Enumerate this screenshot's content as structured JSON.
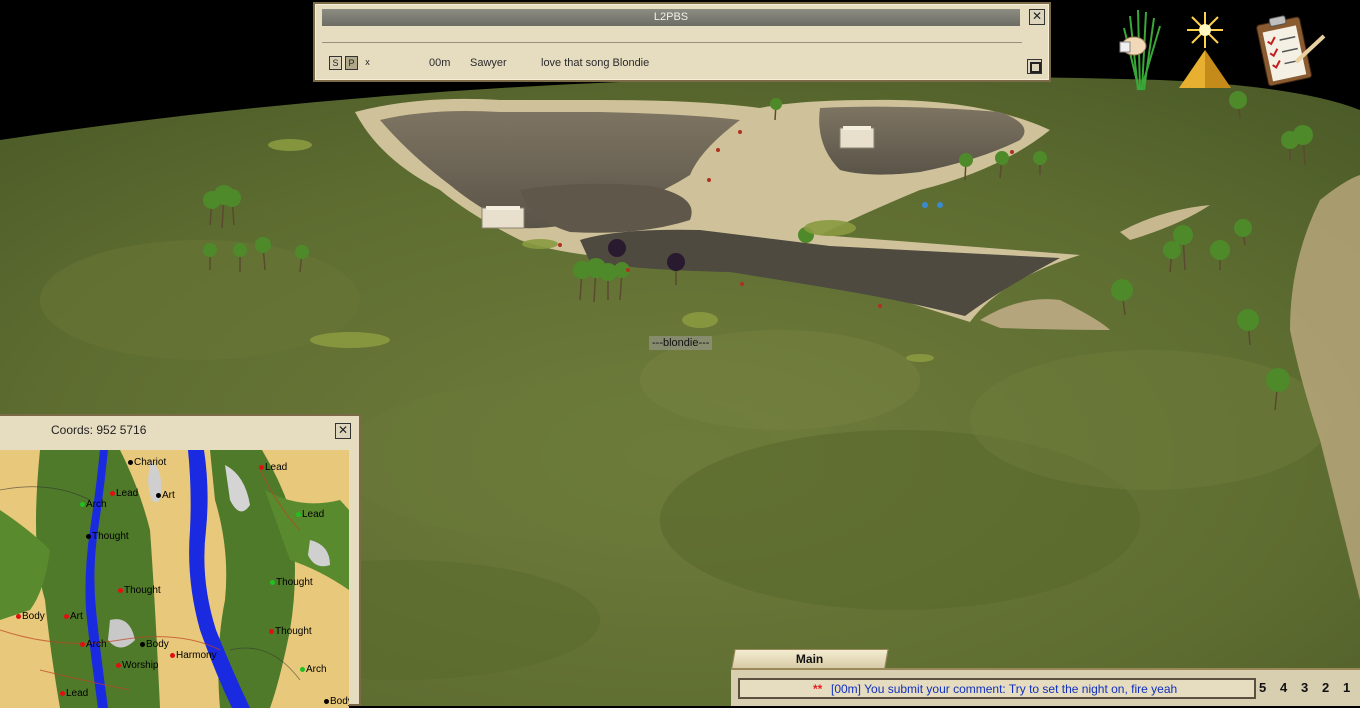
{
  "chat": {
    "title": "L2PBS",
    "close_glyph": "✕",
    "buttons": [
      "S",
      "P",
      "x"
    ],
    "message": {
      "channel": "00m",
      "sender": "Sawyer",
      "text": "love that song Blondie"
    }
  },
  "world": {
    "player_name": "---blondie---"
  },
  "hud_icons": [
    "grain-sheaf-icon",
    "pyramid-sun-icon",
    "clipboard-checklist-icon"
  ],
  "minimap": {
    "coords_label": "Coords: 952 5716",
    "close_glyph": "✕",
    "markers": [
      {
        "label": "Chariot",
        "color": "#000000"
      },
      {
        "label": "Lead",
        "color": "#e01010"
      },
      {
        "label": "Lead",
        "color": "#e01010"
      },
      {
        "label": "Arch",
        "color": "#20c020"
      },
      {
        "label": "Art",
        "color": "#000000"
      },
      {
        "label": "Lead",
        "color": "#20c020"
      },
      {
        "label": "Thought",
        "color": "#000000"
      },
      {
        "label": "Thought",
        "color": "#20c020"
      },
      {
        "label": "Thought",
        "color": "#e01010"
      },
      {
        "label": "Body",
        "color": "#e01010"
      },
      {
        "label": "Art",
        "color": "#e01010"
      },
      {
        "label": "Thought",
        "color": "#e01010"
      },
      {
        "label": "Arch",
        "color": "#e01010"
      },
      {
        "label": "Body",
        "color": "#000000"
      },
      {
        "label": "Harmony",
        "color": "#e01010"
      },
      {
        "label": "Worship",
        "color": "#e01010"
      },
      {
        "label": "Arch",
        "color": "#20c020"
      },
      {
        "label": "Lead",
        "color": "#e01010"
      },
      {
        "label": "Body",
        "color": "#000000"
      }
    ]
  },
  "bottom_chat": {
    "tab_label": "Main",
    "stars": "**",
    "message": "[00m] You submit your comment: Try to set the night on, fire yeah",
    "page_numbers": [
      "5",
      "4",
      "3",
      "2",
      "1"
    ]
  },
  "colors": {
    "parchment": "#e6dcc0",
    "frame": "#7a6a48",
    "grass": "#5c6e2c",
    "river": "#1a2ae0",
    "system_text": "#1030c0"
  }
}
